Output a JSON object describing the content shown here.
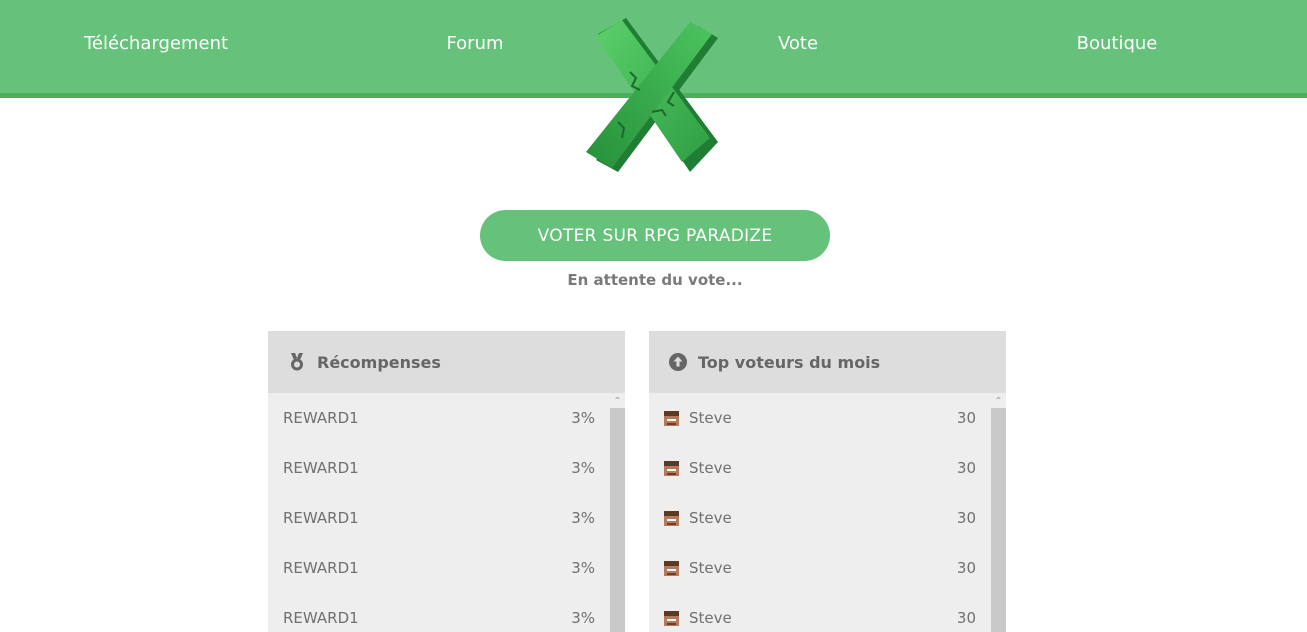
{
  "nav": {
    "items": [
      {
        "label": "Téléchargement"
      },
      {
        "label": "Forum"
      },
      {
        "label": "Vote"
      },
      {
        "label": "Boutique"
      }
    ]
  },
  "vote": {
    "button_label": "VOTER SUR RPG PARADIZE",
    "status": "En attente du vote..."
  },
  "rewards": {
    "title": "Récompenses",
    "icon": "medal-icon",
    "items": [
      {
        "name": "REWARD1",
        "chance": "3%"
      },
      {
        "name": "REWARD1",
        "chance": "3%"
      },
      {
        "name": "REWARD1",
        "chance": "3%"
      },
      {
        "name": "REWARD1",
        "chance": "3%"
      },
      {
        "name": "REWARD1",
        "chance": "3%"
      }
    ]
  },
  "top_voters": {
    "title": "Top voteurs du mois",
    "icon": "arrow-up-circle-icon",
    "items": [
      {
        "name": "Steve",
        "votes": "30"
      },
      {
        "name": "Steve",
        "votes": "30"
      },
      {
        "name": "Steve",
        "votes": "30"
      },
      {
        "name": "Steve",
        "votes": "30"
      },
      {
        "name": "Steve",
        "votes": "30"
      }
    ]
  },
  "colors": {
    "accent": "#66c27b",
    "accent_dark": "#4caf5e",
    "panel_bg": "#eeeeee",
    "panel_head_bg": "#dddddd"
  }
}
